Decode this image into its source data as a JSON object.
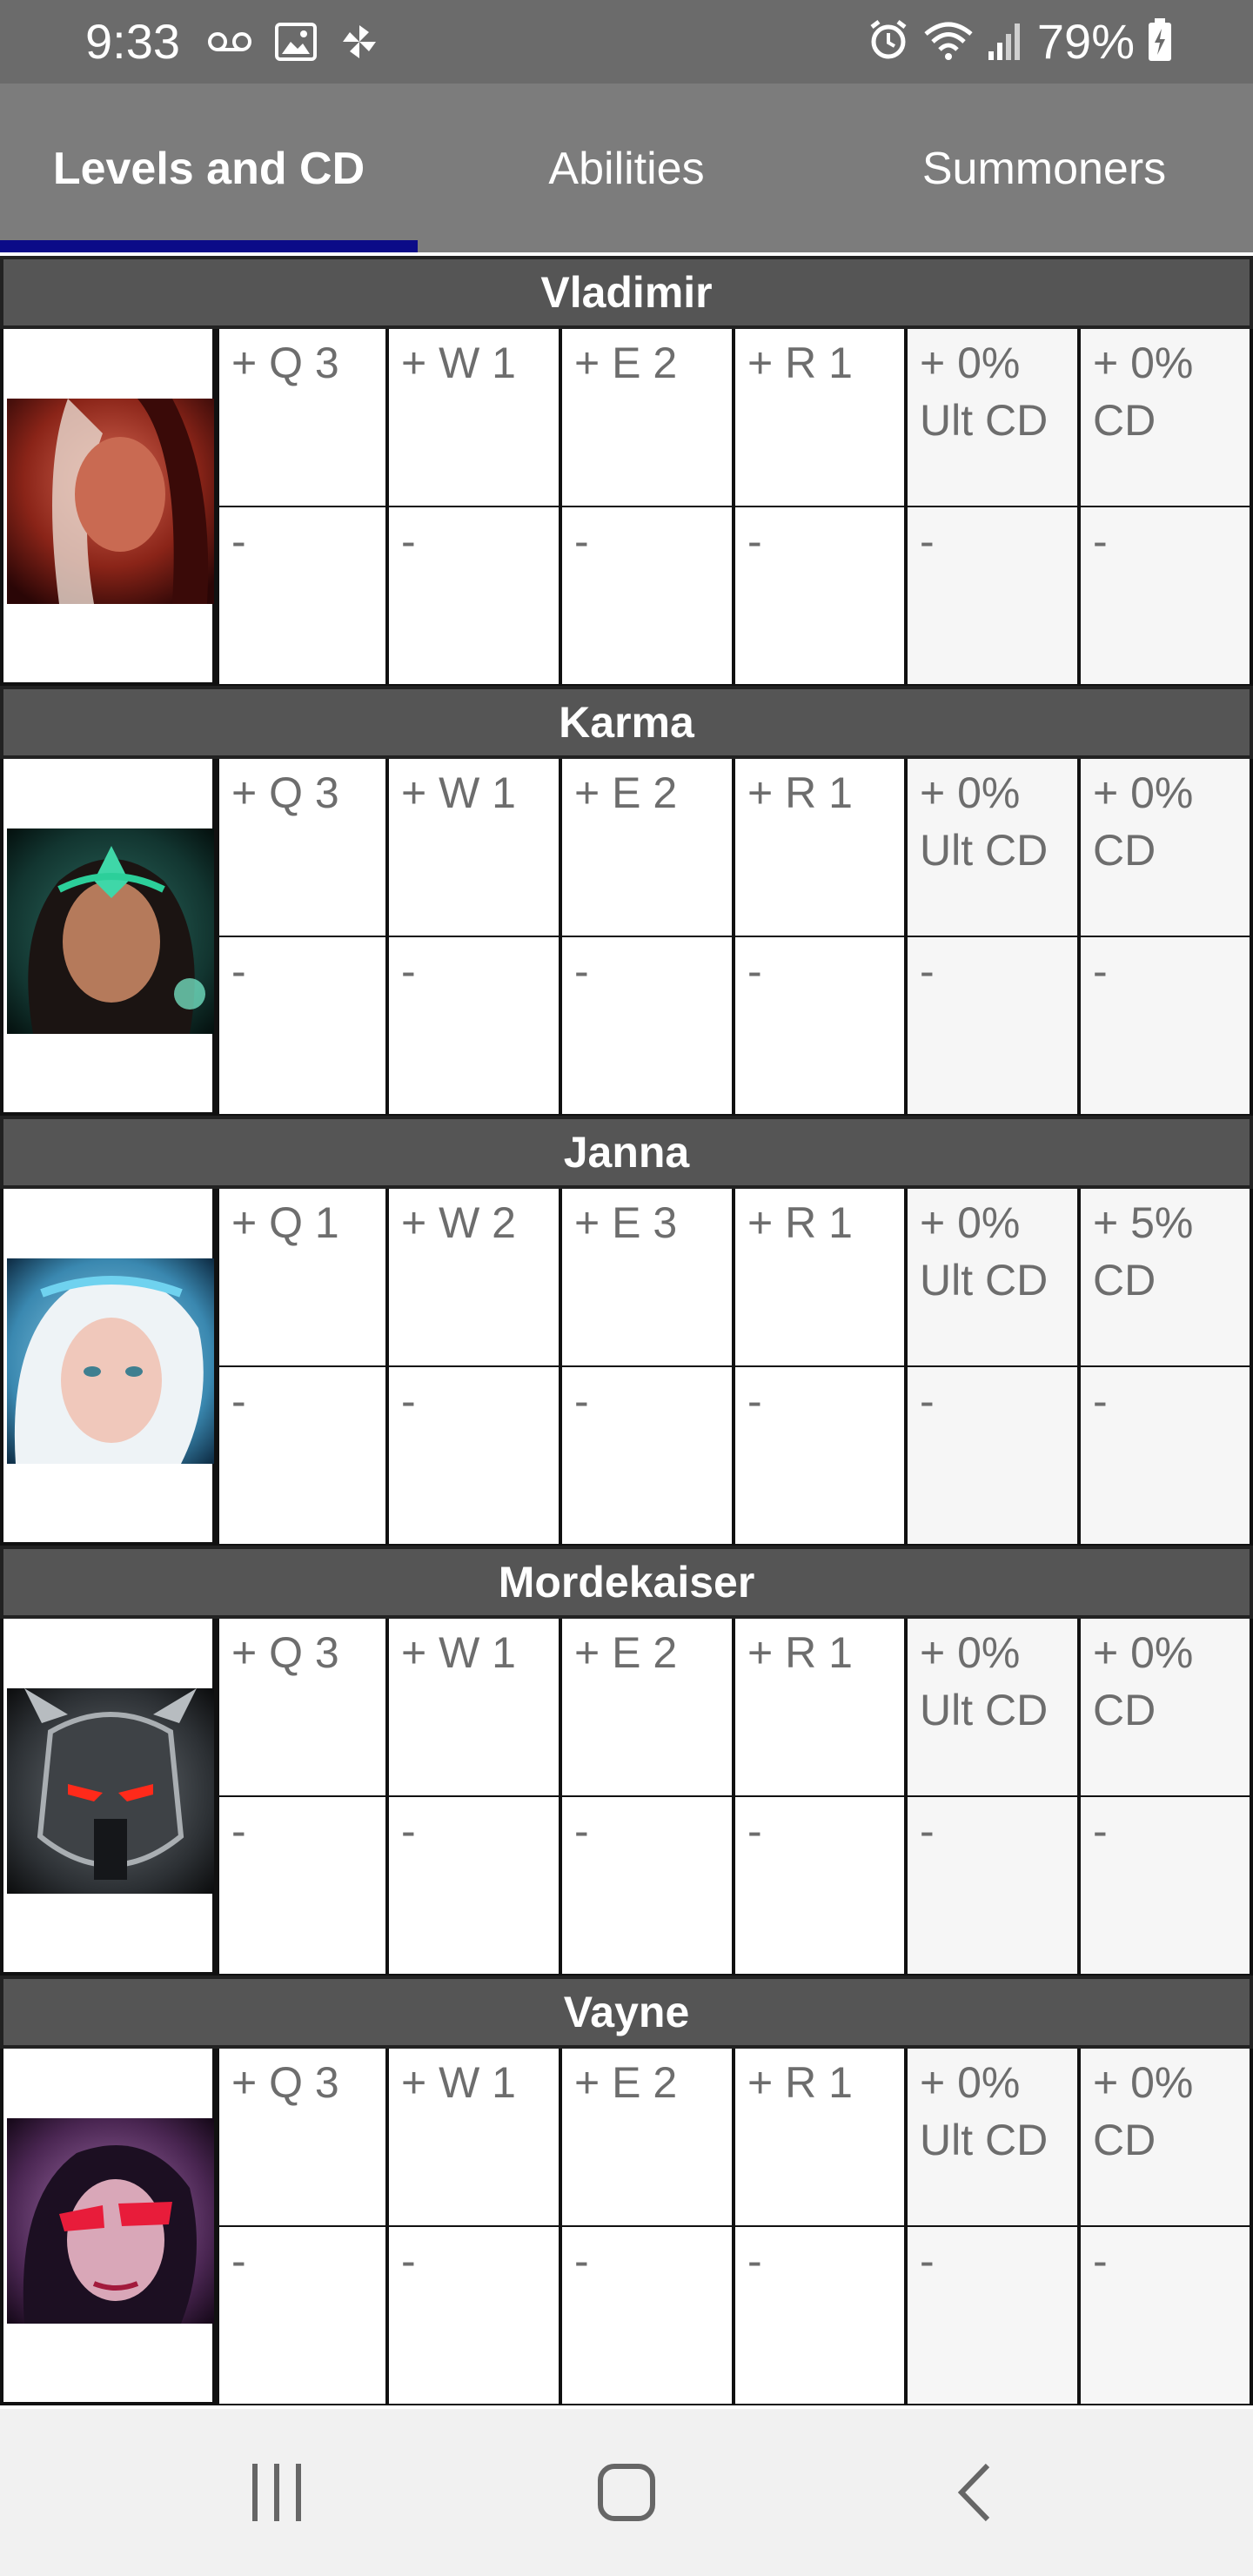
{
  "status_bar": {
    "time": "9:33",
    "battery": "79%",
    "icons": [
      "voicemail-icon",
      "image-icon",
      "pinwheel-icon",
      "alarm-icon",
      "wifi-icon",
      "signal-icon",
      "battery-charging-icon"
    ]
  },
  "tabs": [
    {
      "label": "Levels and CD",
      "active": true
    },
    {
      "label": "Abilities",
      "active": false
    },
    {
      "label": "Summoners",
      "active": false
    }
  ],
  "champions": [
    {
      "name": "Vladimir",
      "top": [
        "+ Q 3",
        "+ W 1",
        "+ E 2",
        "+ R 1",
        "+ 0% Ult CD",
        "+ 0% CD"
      ],
      "bottom": [
        "-",
        "-",
        "-",
        "-",
        "-",
        "-"
      ]
    },
    {
      "name": "Karma",
      "top": [
        "+ Q 3",
        "+ W 1",
        "+ E 2",
        "+ R 1",
        "+ 0% Ult CD",
        "+ 0% CD"
      ],
      "bottom": [
        "-",
        "-",
        "-",
        "-",
        "-",
        "-"
      ]
    },
    {
      "name": "Janna",
      "top": [
        "+ Q 1",
        "+ W 2",
        "+ E 3",
        "+ R 1",
        "+ 0% Ult CD",
        "+ 5% CD"
      ],
      "bottom": [
        "-",
        "-",
        "-",
        "-",
        "-",
        "-"
      ]
    },
    {
      "name": "Mordekaiser",
      "top": [
        "+ Q 3",
        "+ W 1",
        "+ E 2",
        "+ R 1",
        "+ 0% Ult CD",
        "+ 0% CD"
      ],
      "bottom": [
        "-",
        "-",
        "-",
        "-",
        "-",
        "-"
      ]
    },
    {
      "name": "Vayne",
      "top": [
        "+ Q 3",
        "+ W 1",
        "+ E 2",
        "+ R 1",
        "+ 0% Ult CD",
        "+ 0% CD"
      ],
      "bottom": [
        "-",
        "-",
        "-",
        "-",
        "-",
        "-"
      ]
    }
  ],
  "nav_bar": {
    "icons": [
      "recent-apps-icon",
      "home-icon",
      "back-icon"
    ]
  },
  "colors": {
    "status_bar": "#6b6b6b",
    "tab_bar": "#7c7c7c",
    "tab_indicator": "#0b0b88",
    "champion_header": "#555555"
  }
}
